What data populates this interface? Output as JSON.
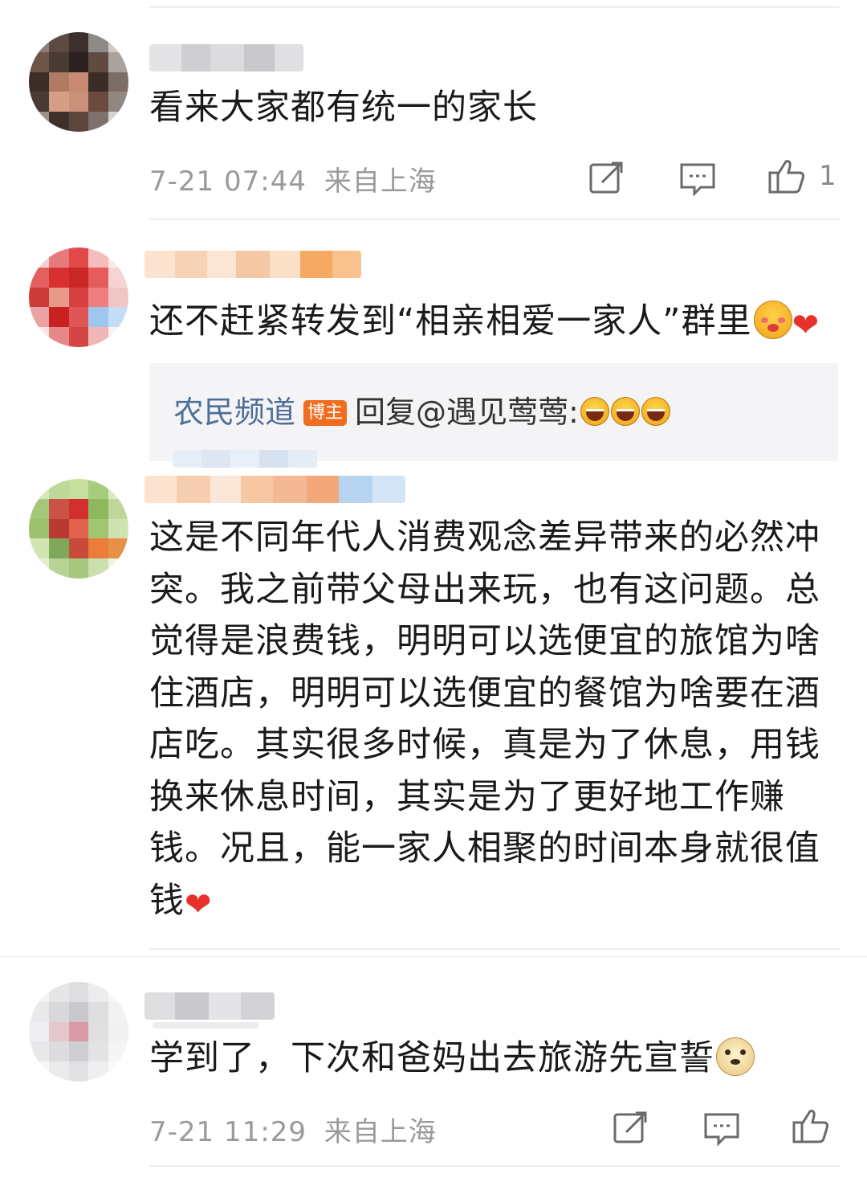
{
  "comments": [
    {
      "text": "看来大家都有统一的家长",
      "time": "7-21 07:44",
      "location": "来自上海",
      "likes": "1"
    },
    {
      "text": "还不赶紧转发到“相亲相爱一家人”群里",
      "emojis": [
        "blush-kiss-emoji",
        "red-heart-emoji"
      ],
      "reply": {
        "author": "农民频道",
        "badge": "博主",
        "prefix": "回复@遇见莺莺:",
        "emojis": [
          "grin-emoji",
          "grin-emoji",
          "grin-emoji"
        ]
      }
    },
    {
      "text": "这是不同年代人消费观念差异带来的必然冲突。我之前带父母出来玩，也有这问题。总觉得是浪费钱，明明可以选便宜的旅馆为啥住酒店，明明可以选便宜的餐馆为啥要在酒店吃。其实很多时候，真是为了休息，用钱换来休息时间，其实是为了更好地工作赚钱。况且，能一家人相聚的时间本身就很值钱",
      "emojis": [
        "red-heart-emoji"
      ]
    },
    {
      "text": "学到了，下次和爸妈出去旅游先宣誓",
      "emojis": [
        "doge-emoji"
      ],
      "time": "7-21 11:29",
      "location": "来自上海"
    }
  ],
  "icons": {
    "repost": "repost-icon",
    "comment": "comment-icon",
    "like": "thumbs-up-icon"
  },
  "colors": {
    "reply_author": "#4e6e98",
    "badge": "#f06d1f",
    "heart": "#e8302c",
    "meta": "#9a9a9a"
  }
}
